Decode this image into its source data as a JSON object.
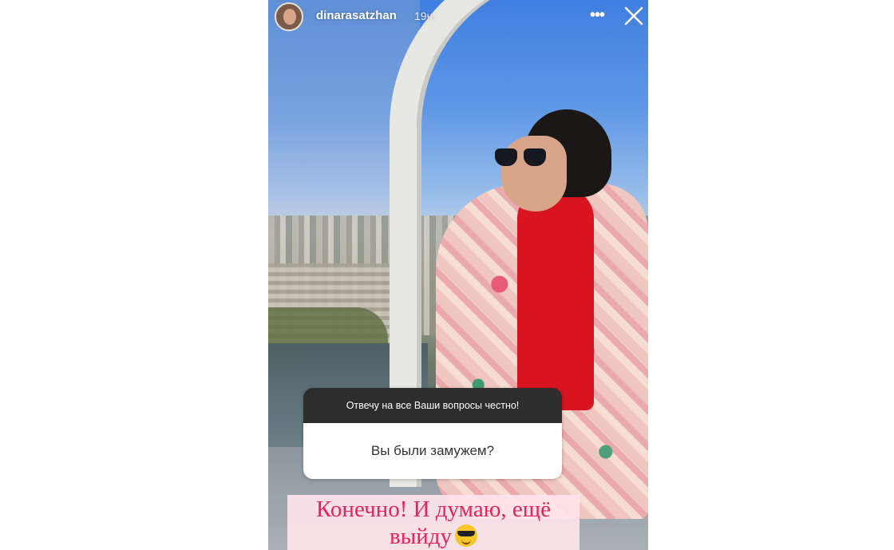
{
  "header": {
    "username": "dinarasatzhan",
    "time": "19ч.",
    "more_icon": "more-dots-icon",
    "close_icon": "close-icon"
  },
  "question_sticker": {
    "prompt": "Отвечу на все Ваши вопросы честно!",
    "question": "Вы были замужем?"
  },
  "answer": {
    "line1": "Конечно! И думаю, ещё",
    "line2": "выйду",
    "emoji_icon": "sunglasses-emoji-icon"
  },
  "colors": {
    "answer_text": "#e4245a",
    "question_header_bg": "#2d2d2d"
  }
}
